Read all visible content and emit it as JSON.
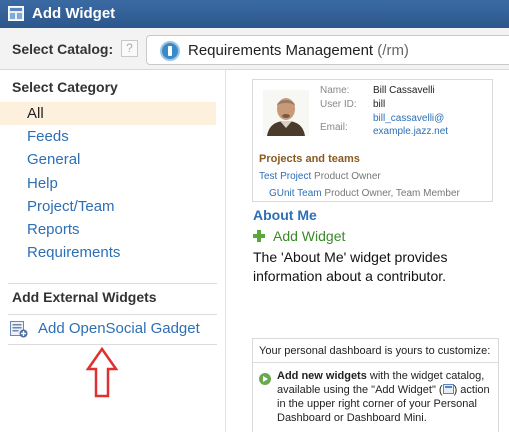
{
  "window": {
    "title": "Add Widget"
  },
  "catalog": {
    "label": "Select Catalog:",
    "help": "?",
    "selected_name": "Requirements Management",
    "selected_path": "(/rm)"
  },
  "categories": {
    "heading": "Select Category",
    "items": [
      "All",
      "Feeds",
      "General",
      "Help",
      "Project/Team",
      "Reports",
      "Requirements"
    ],
    "selected_index": 0
  },
  "external": {
    "heading": "Add External Widgets",
    "link": "Add OpenSocial Gadget"
  },
  "preview": {
    "fields": [
      {
        "key": "Name:",
        "value": "Bill Cassavelli"
      },
      {
        "key": "User ID:",
        "value": "bill"
      },
      {
        "key": "Email:",
        "value_line1": "bill_cassavelli@",
        "value_line2": "example.jazz.net"
      }
    ],
    "projects_heading": "Projects and teams",
    "projects": [
      {
        "name": "Test Project",
        "role": "Product Owner"
      },
      {
        "name": "GUnit Team",
        "role": "Product Owner, Team Member"
      }
    ]
  },
  "widget": {
    "title": "About Me",
    "add_label": "Add Widget",
    "description": "The 'About Me' widget provides information about a contributor."
  },
  "dashboard_help": {
    "title": "Your personal dashboard is yours to customize:",
    "bold": "Add new widgets",
    "text_1": " with the widget catalog, available using the \"Add Widget\" (",
    "text_2": ") action in the upper right corner of your Personal Dashboard or Dashboard Mini."
  },
  "colors": {
    "titlebar": "#2c578c",
    "link": "#2d6fb5",
    "selected_bg": "#fdf0dd",
    "add_green": "#3a8a2a",
    "annotation_arrow": "#e03030"
  },
  "icons": [
    "add-widget-icon",
    "help-icon",
    "catalog-icon",
    "gadget-icon",
    "plus-icon",
    "arrow-right-icon",
    "annotation-arrow-icon"
  ]
}
